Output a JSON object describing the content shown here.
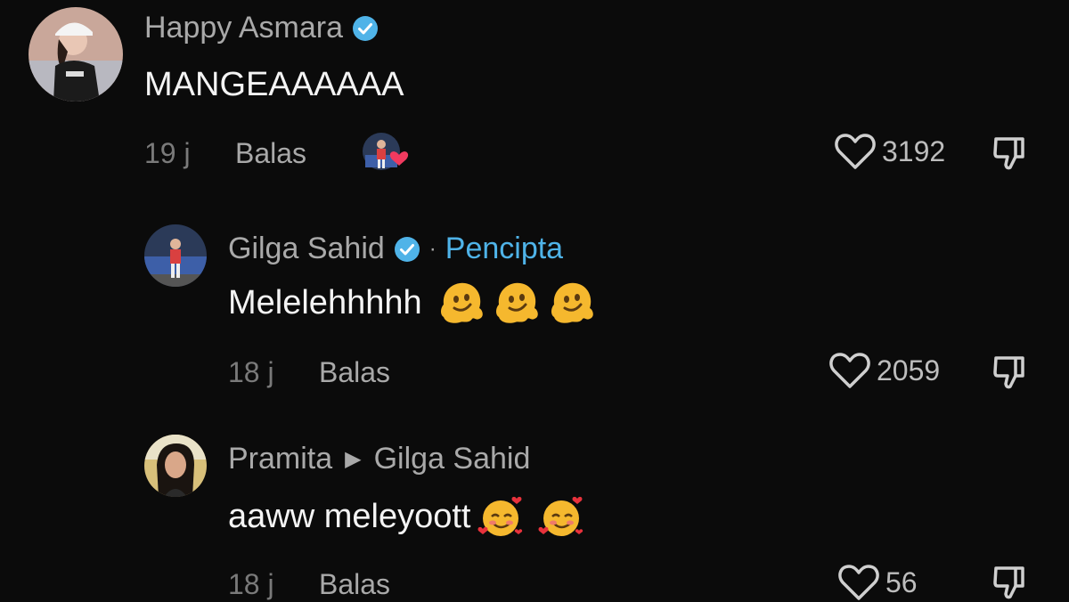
{
  "comments": [
    {
      "author": "Happy Asmara",
      "verified": true,
      "text": "MANGEAAAAAA",
      "time": "19 j",
      "reply_label": "Balas",
      "likes": "3192",
      "liked_by_creator": true
    },
    {
      "author": "Gilga Sahid",
      "verified": true,
      "separator": "·",
      "creator_badge": "Pencipta",
      "text": "Melelehhhhh",
      "emoji": [
        "melting-face",
        "melting-face",
        "melting-face"
      ],
      "time": "18 j",
      "reply_label": "Balas",
      "likes": "2059"
    },
    {
      "author": "Pramita",
      "reply_to": "Gilga Sahid",
      "text": "aaww meleyoott",
      "emoji": [
        "smiling-face-with-hearts",
        "smiling-face-with-hearts"
      ],
      "time": "18 j",
      "reply_label": "Balas",
      "likes": "56"
    }
  ],
  "colors": {
    "background": "#0b0b0b",
    "verified": "#4fb3e8",
    "creator_label": "#4fb3e8",
    "heart": "#f03a5f"
  }
}
